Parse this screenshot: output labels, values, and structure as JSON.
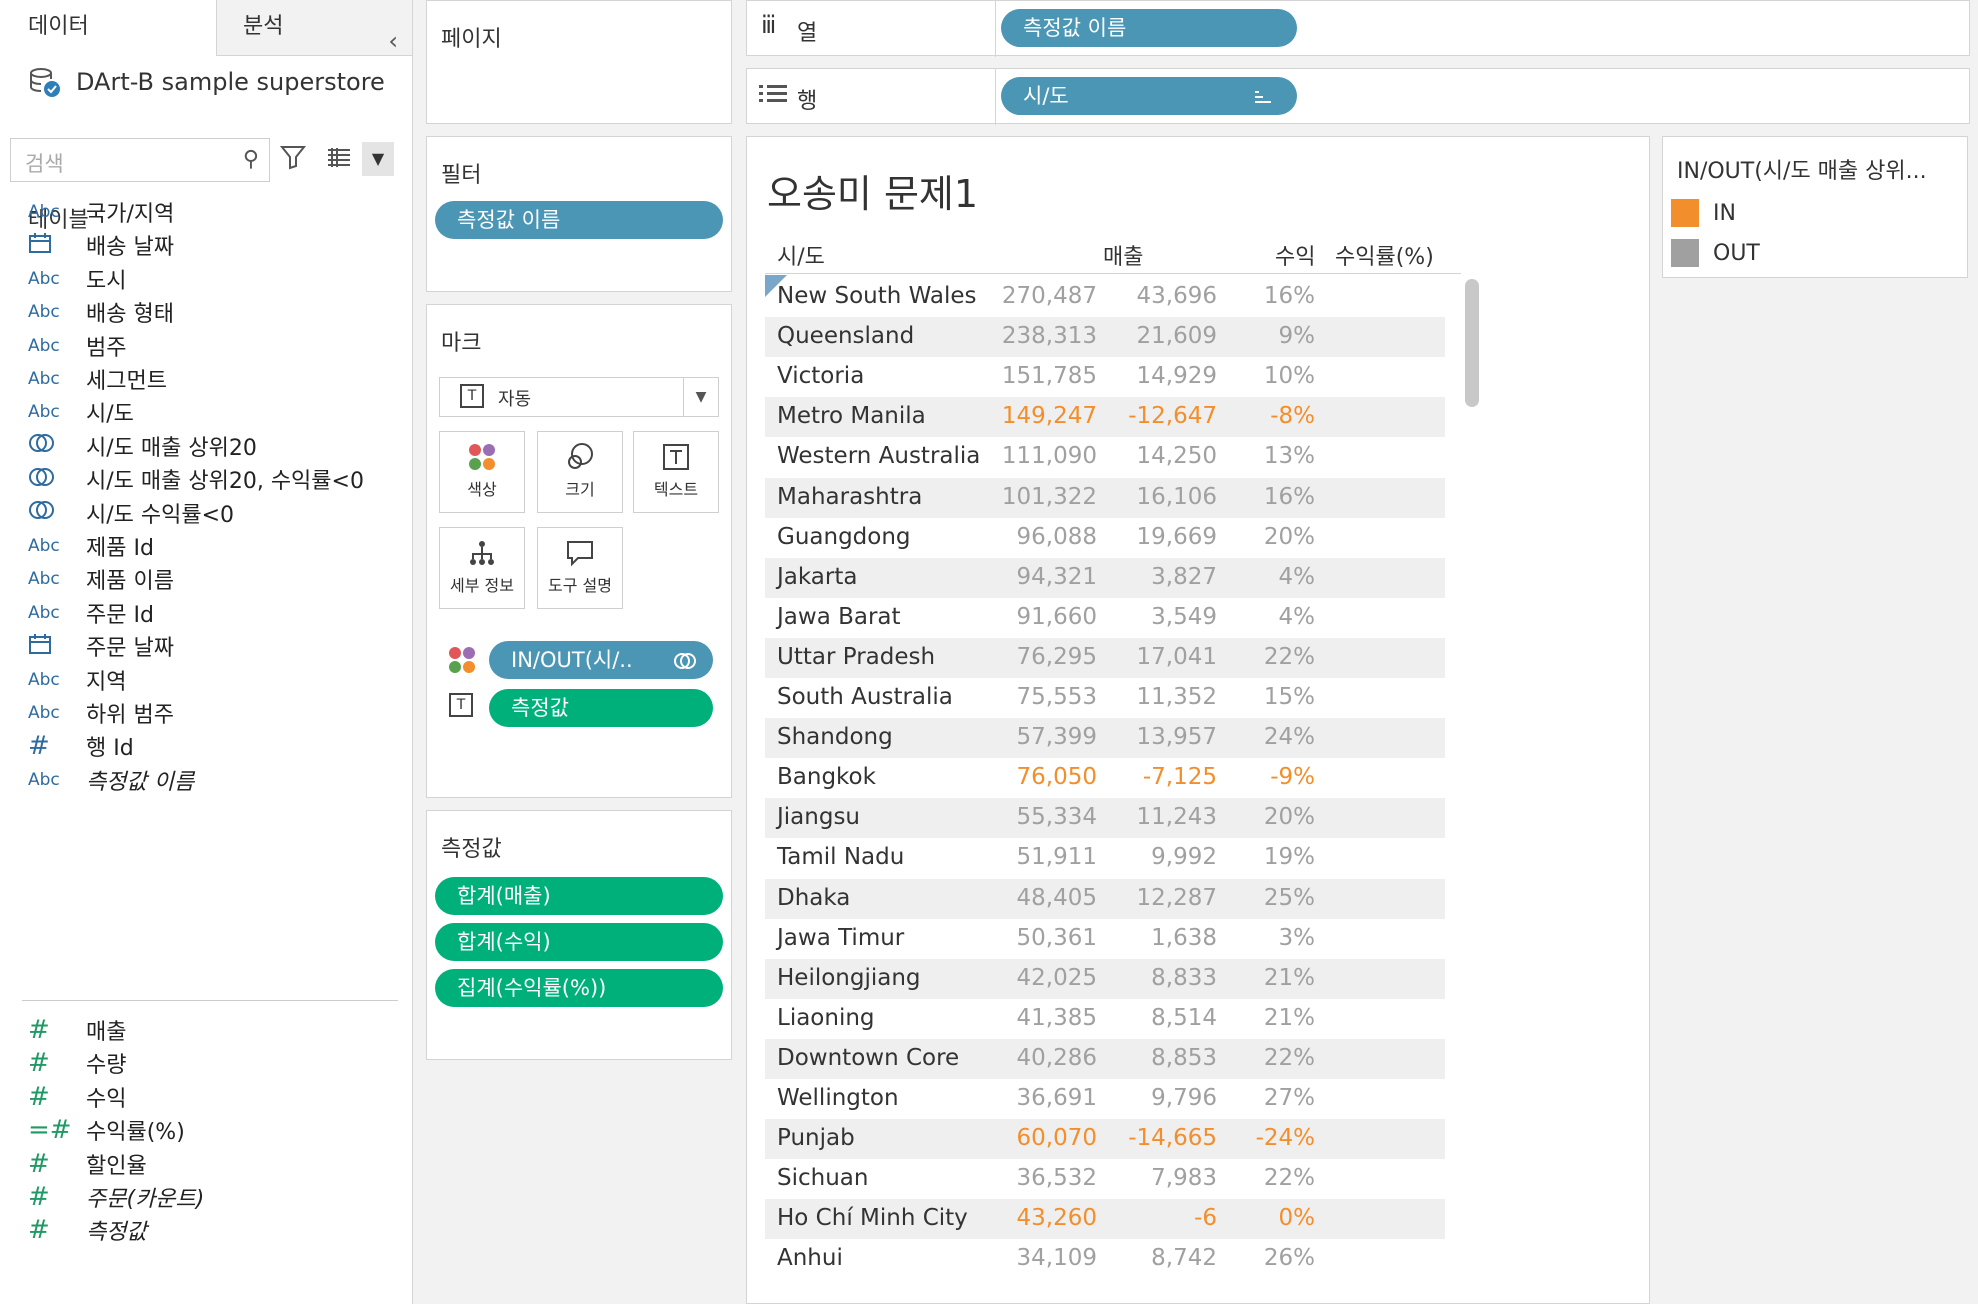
{
  "left_pane": {
    "tabs": [
      "데이터",
      "분석"
    ],
    "datasource": "DArt-B sample superstore",
    "search_placeholder": "검색",
    "section_title": "테이블",
    "dimensions": [
      {
        "type": "Abc",
        "name": "국가/지역"
      },
      {
        "type": "date",
        "name": "배송 날짜"
      },
      {
        "type": "Abc",
        "name": "도시"
      },
      {
        "type": "Abc",
        "name": "배송 형태"
      },
      {
        "type": "Abc",
        "name": "범주"
      },
      {
        "type": "Abc",
        "name": "세그먼트"
      },
      {
        "type": "Abc",
        "name": "시/도"
      },
      {
        "type": "set",
        "name": "시/도 매출 상위20"
      },
      {
        "type": "set",
        "name": "시/도 매출 상위20, 수익률<0"
      },
      {
        "type": "set",
        "name": "시/도 수익률<0"
      },
      {
        "type": "Abc",
        "name": "제품 Id"
      },
      {
        "type": "Abc",
        "name": "제품 이름"
      },
      {
        "type": "Abc",
        "name": "주문 Id"
      },
      {
        "type": "date",
        "name": "주문 날짜"
      },
      {
        "type": "Abc",
        "name": "지역"
      },
      {
        "type": "Abc",
        "name": "하위 범주"
      },
      {
        "type": "#",
        "name": "행 Id"
      },
      {
        "type": "Abc",
        "name": "측정값 이름"
      }
    ],
    "measures": [
      {
        "type": "#",
        "name": "매출"
      },
      {
        "type": "#",
        "name": "수량"
      },
      {
        "type": "#",
        "name": "수익"
      },
      {
        "type": "=#",
        "name": "수익률(%)"
      },
      {
        "type": "#",
        "name": "할인율"
      },
      {
        "type": "#",
        "name": "주문(카운트)"
      },
      {
        "type": "#",
        "name": "측정값"
      }
    ]
  },
  "shelves": {
    "pages_title": "페이지",
    "filters_title": "필터",
    "filter_pill": "측정값 이름",
    "columns_label": "열",
    "columns_pill": "측정값 이름",
    "rows_label": "행",
    "rows_pill": "시/도",
    "marks_title": "마크",
    "mark_type": "자동",
    "mark_buttons": [
      "색상",
      "크기",
      "텍스트",
      "세부 정보",
      "도구 설명"
    ],
    "color_pill": "IN/OUT(시/..",
    "text_pill": "측정값",
    "measure_values_title": "측정값",
    "measure_values": [
      "합계(매출)",
      "합계(수익)",
      "집계(수익률(%))"
    ]
  },
  "view": {
    "title": "오송미 문제1",
    "headers": {
      "state": "시/도",
      "sales": "매출",
      "profit": "수익",
      "ratio": "수익률(%)"
    },
    "rows": [
      {
        "state": "New South Wales",
        "sales": "270,487",
        "profit": "43,696",
        "ratio": "16%",
        "group": "IN"
      },
      {
        "state": "Queensland",
        "sales": "238,313",
        "profit": "21,609",
        "ratio": "9%",
        "group": "IN"
      },
      {
        "state": "Victoria",
        "sales": "151,785",
        "profit": "14,929",
        "ratio": "10%",
        "group": "IN"
      },
      {
        "state": "Metro Manila",
        "sales": "149,247",
        "profit": "-12,647",
        "ratio": "-8%",
        "group": "OUT"
      },
      {
        "state": "Western Australia",
        "sales": "111,090",
        "profit": "14,250",
        "ratio": "13%",
        "group": "IN"
      },
      {
        "state": "Maharashtra",
        "sales": "101,322",
        "profit": "16,106",
        "ratio": "16%",
        "group": "IN"
      },
      {
        "state": "Guangdong",
        "sales": "96,088",
        "profit": "19,669",
        "ratio": "20%",
        "group": "IN"
      },
      {
        "state": "Jakarta",
        "sales": "94,321",
        "profit": "3,827",
        "ratio": "4%",
        "group": "IN"
      },
      {
        "state": "Jawa Barat",
        "sales": "91,660",
        "profit": "3,549",
        "ratio": "4%",
        "group": "IN"
      },
      {
        "state": "Uttar Pradesh",
        "sales": "76,295",
        "profit": "17,041",
        "ratio": "22%",
        "group": "IN"
      },
      {
        "state": "South Australia",
        "sales": "75,553",
        "profit": "11,352",
        "ratio": "15%",
        "group": "IN"
      },
      {
        "state": "Shandong",
        "sales": "57,399",
        "profit": "13,957",
        "ratio": "24%",
        "group": "IN"
      },
      {
        "state": "Bangkok",
        "sales": "76,050",
        "profit": "-7,125",
        "ratio": "-9%",
        "group": "OUT"
      },
      {
        "state": "Jiangsu",
        "sales": "55,334",
        "profit": "11,243",
        "ratio": "20%",
        "group": "IN"
      },
      {
        "state": "Tamil Nadu",
        "sales": "51,911",
        "profit": "9,992",
        "ratio": "19%",
        "group": "IN"
      },
      {
        "state": "Dhaka",
        "sales": "48,405",
        "profit": "12,287",
        "ratio": "25%",
        "group": "IN"
      },
      {
        "state": "Jawa Timur",
        "sales": "50,361",
        "profit": "1,638",
        "ratio": "3%",
        "group": "IN"
      },
      {
        "state": "Heilongjiang",
        "sales": "42,025",
        "profit": "8,833",
        "ratio": "21%",
        "group": "IN"
      },
      {
        "state": "Liaoning",
        "sales": "41,385",
        "profit": "8,514",
        "ratio": "21%",
        "group": "IN"
      },
      {
        "state": "Downtown Core",
        "sales": "40,286",
        "profit": "8,853",
        "ratio": "22%",
        "group": "IN"
      },
      {
        "state": "Wellington",
        "sales": "36,691",
        "profit": "9,796",
        "ratio": "27%",
        "group": "IN"
      },
      {
        "state": "Punjab",
        "sales": "60,070",
        "profit": "-14,665",
        "ratio": "-24%",
        "group": "OUT"
      },
      {
        "state": "Sichuan",
        "sales": "36,532",
        "profit": "7,983",
        "ratio": "22%",
        "group": "IN"
      },
      {
        "state": "Ho Chí Minh City",
        "sales": "43,260",
        "profit": "-6",
        "ratio": "0%",
        "group": "OUT"
      },
      {
        "state": "Anhui",
        "sales": "34,109",
        "profit": "8,742",
        "ratio": "26%",
        "group": "IN"
      }
    ]
  },
  "legend": {
    "title": "IN/OUT(시/도 매출 상위...",
    "items": [
      {
        "label": "IN",
        "color": "#f28e2b"
      },
      {
        "label": "OUT",
        "color": "#a0a0a0"
      }
    ]
  },
  "colors": {
    "pill_blue": "#4c96b5",
    "pill_green": "#00b07a",
    "out_text": "#f28e2b",
    "in_text": "#a0a0a0"
  }
}
